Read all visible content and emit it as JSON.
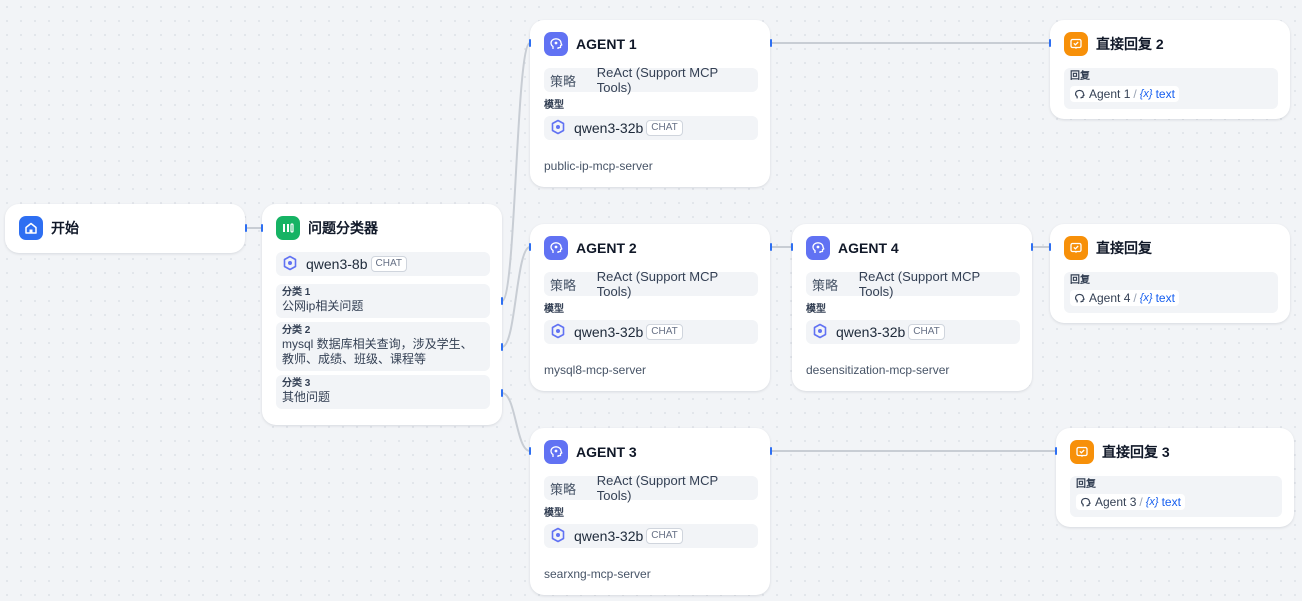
{
  "colors": {
    "edge": "#c8cdd4",
    "handle": "#2e6ff2"
  },
  "start": {
    "title": "开始",
    "icon": "home-icon"
  },
  "classifier": {
    "title": "问题分类器",
    "icon": "classifier-icon",
    "model": "qwen3-8b",
    "model_badge": "CHAT",
    "classes": [
      {
        "label": "分类 1",
        "text": "公网ip相关问题"
      },
      {
        "label": "分类 2",
        "text": "mysql 数据库相关查询，涉及学生、教师、成绩、班级、课程等"
      },
      {
        "label": "分类 3",
        "text": "其他问题"
      }
    ]
  },
  "agents": [
    {
      "title": "AGENT 1",
      "strategy_key": "策略",
      "strategy_value": "ReAct (Support MCP Tools)",
      "model_label": "模型",
      "model": "qwen3-32b",
      "model_badge": "CHAT",
      "server": "public-ip-mcp-server"
    },
    {
      "title": "AGENT 2",
      "strategy_key": "策略",
      "strategy_value": "ReAct (Support MCP Tools)",
      "model_label": "模型",
      "model": "qwen3-32b",
      "model_badge": "CHAT",
      "server": "mysql8-mcp-server"
    },
    {
      "title": "AGENT 3",
      "strategy_key": "策略",
      "strategy_value": "ReAct (Support MCP Tools)",
      "model_label": "模型",
      "model": "qwen3-32b",
      "model_badge": "CHAT",
      "server": "searxng-mcp-server"
    },
    {
      "title": "AGENT 4",
      "strategy_key": "策略",
      "strategy_value": "ReAct (Support MCP Tools)",
      "model_label": "模型",
      "model": "qwen3-32b",
      "model_badge": "CHAT",
      "server": "desensitization-mcp-server"
    }
  ],
  "replies": [
    {
      "title": "直接回复 2",
      "label": "回复",
      "source": "Agent 1",
      "sep": "/",
      "var_symbol": "{x}",
      "var": "text"
    },
    {
      "title": "直接回复",
      "label": "回复",
      "source": "Agent 4",
      "sep": "/",
      "var_symbol": "{x}",
      "var": "text"
    },
    {
      "title": "直接回复 3",
      "label": "回复",
      "source": "Agent 3",
      "sep": "/",
      "var_symbol": "{x}",
      "var": "text"
    }
  ]
}
